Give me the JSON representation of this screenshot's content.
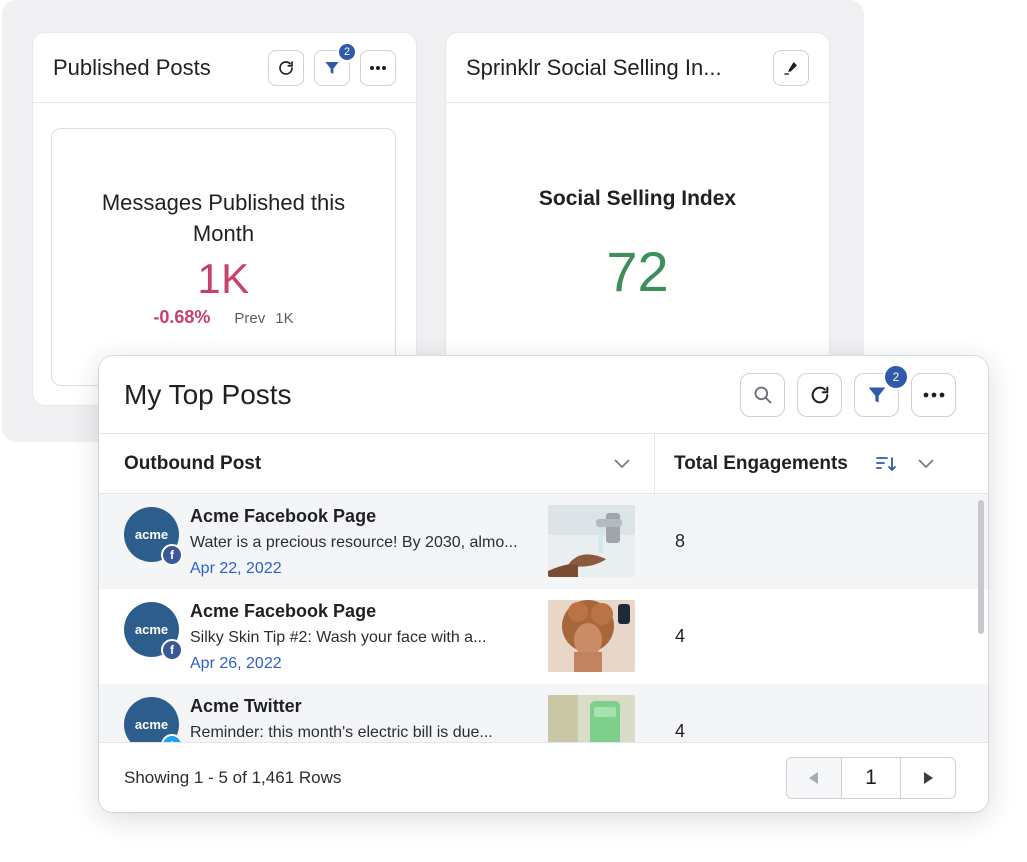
{
  "published_posts": {
    "title": "Published Posts",
    "filter_badge": "2",
    "metric": {
      "label": "Messages Published this Month",
      "value": "1K",
      "delta": "-0.68%",
      "prev_label": "Prev",
      "prev_value": "1K"
    },
    "icons": [
      "refresh-icon",
      "filter-icon",
      "more-icon"
    ]
  },
  "ssi": {
    "title": "Sprinklr Social Selling In...",
    "label": "Social Selling Index",
    "value": "72",
    "icons": [
      "edit-icon"
    ]
  },
  "top_posts": {
    "title": "My Top Posts",
    "filter_badge": "2",
    "columns": [
      "Outbound Post",
      "Total Engagements"
    ],
    "rows": [
      {
        "avatar_text": "acme",
        "network": "facebook",
        "account": "Acme Facebook Page",
        "message": "Water is a precious resource! By 2030, almo...",
        "date": "Apr 22, 2022",
        "engagements": "8"
      },
      {
        "avatar_text": "acme",
        "network": "facebook",
        "account": "Acme Facebook Page",
        "message": "Silky Skin Tip #2: Wash your face with a...",
        "date": "Apr 26, 2022",
        "engagements": "4"
      },
      {
        "avatar_text": "acme",
        "network": "twitter",
        "account": "Acme Twitter",
        "message": "Reminder: this month's electric bill is due...",
        "date": "",
        "engagements": "4"
      }
    ],
    "footer": {
      "showing": "Showing 1 - 5 of 1,461 Rows",
      "page": "1"
    },
    "icons": [
      "search-icon",
      "refresh-icon",
      "filter-icon",
      "more-icon",
      "sort-icon",
      "chevron-down-icon",
      "chevron-left-icon",
      "chevron-right-icon"
    ]
  },
  "colors": {
    "metric_negative": "#c9406a",
    "ssi_value": "#3d8f5a",
    "badge": "#2e5aa8",
    "date_link": "#2d5fd0",
    "avatar": "#2c5d8c",
    "facebook": "#3b5998",
    "twitter": "#1da1f2"
  }
}
